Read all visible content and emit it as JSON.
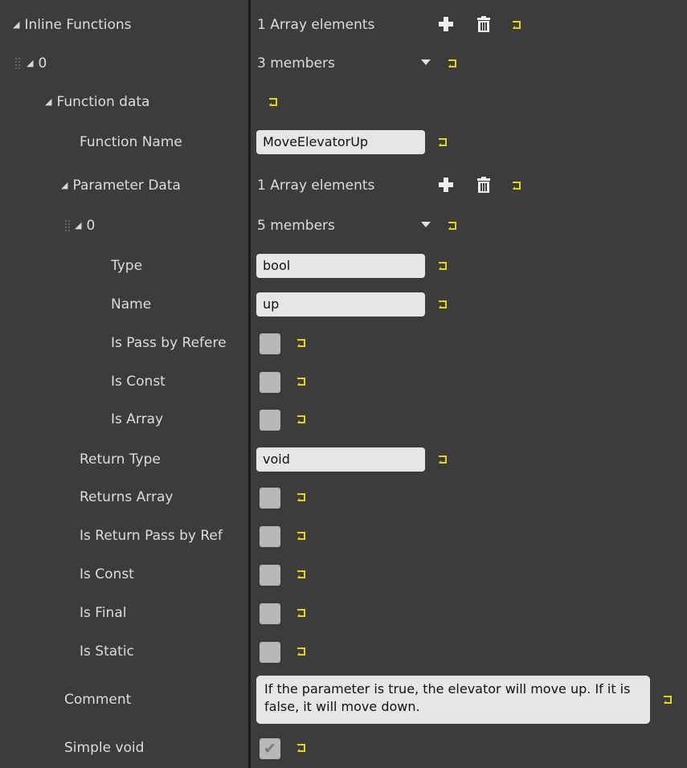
{
  "rows": {
    "inline_functions": {
      "label": "Inline Functions",
      "value": "1 Array elements"
    },
    "item0": {
      "label": "0",
      "value": "3 members"
    },
    "function_data": {
      "label": "Function data"
    },
    "function_name": {
      "label": "Function Name",
      "value": "MoveElevatorUp"
    },
    "parameter_data": {
      "label": "Parameter Data",
      "value": "1 Array elements"
    },
    "param0": {
      "label": "0",
      "value": "5 members"
    },
    "type": {
      "label": "Type",
      "value": "bool"
    },
    "name": {
      "label": "Name",
      "value": "up"
    },
    "is_pass_by_ref": {
      "label": "Is Pass by Refere",
      "checked": false
    },
    "param_is_const": {
      "label": "Is Const",
      "checked": false
    },
    "is_array": {
      "label": "Is Array",
      "checked": false
    },
    "return_type": {
      "label": "Return Type",
      "value": "void"
    },
    "returns_array": {
      "label": "Returns Array",
      "checked": false
    },
    "is_return_pass_by_ref": {
      "label": "Is Return Pass by Ref",
      "checked": false
    },
    "is_const": {
      "label": "Is Const",
      "checked": false
    },
    "is_final": {
      "label": "Is Final",
      "checked": false
    },
    "is_static": {
      "label": "Is Static",
      "checked": false
    },
    "comment": {
      "label": "Comment",
      "value": "If the parameter is true, the elevator will move up. If it is false, it will move down."
    },
    "simple_void": {
      "label": "Simple void",
      "checked": true
    }
  },
  "icons": {
    "expand": "triangle-expanded-icon",
    "add": "plus-icon",
    "delete": "trash-icon",
    "reset": "reset-to-default-icon",
    "dropdown": "chevron-down-icon",
    "drag": "drag-handle-icon"
  },
  "colors": {
    "background": "#3c3c3c",
    "divider": "#1c1c1c",
    "field": "#e6e6e6",
    "checkbox": "#b8b8b8",
    "reset_arrow": "#e8d414"
  }
}
